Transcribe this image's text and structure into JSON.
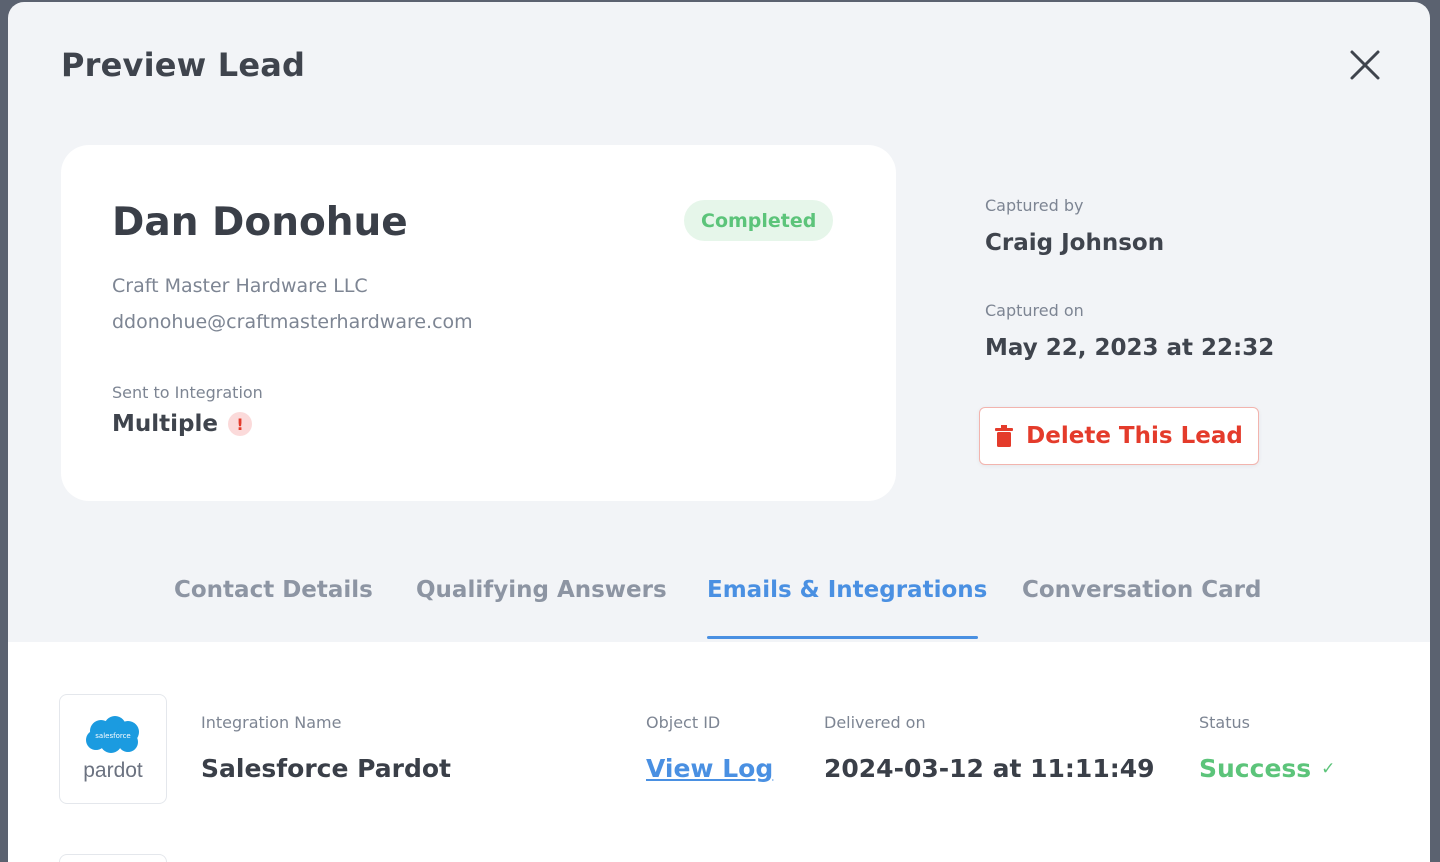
{
  "modal": {
    "title": "Preview Lead"
  },
  "lead": {
    "name": "Dan Donohue",
    "status": "Completed",
    "company": "Craft Master Hardware LLC",
    "email": "ddonohue@craftmasterhardware.com",
    "sent_label": "Sent to Integration",
    "sent_value": "Multiple",
    "alert_symbol": "!"
  },
  "meta": {
    "captured_by_label": "Captured by",
    "captured_by": "Craig Johnson",
    "captured_on_label": "Captured on",
    "captured_on": "May 22, 2023 at 22:32"
  },
  "actions": {
    "delete_label": "Delete This Lead"
  },
  "tabs": [
    {
      "label": "Contact Details",
      "active": false
    },
    {
      "label": "Qualifying Answers",
      "active": false
    },
    {
      "label": "Emails & Integrations",
      "active": true
    },
    {
      "label": "Conversation Card",
      "active": false
    }
  ],
  "integration": {
    "logo_brand": "salesforce",
    "logo_text": "pardot",
    "name_label": "Integration Name",
    "name": "Salesforce Pardot",
    "object_label": "Object ID",
    "object_link": "View Log",
    "delivered_label": "Delivered on",
    "delivered": "2024-03-12 at 11:11:49",
    "status_label": "Status",
    "status": "Success",
    "status_symbol": "✓"
  },
  "colors": {
    "accent": "#4a90e2",
    "success": "#5cc47a",
    "danger": "#e43b2b",
    "salesforce": "#1b9be0"
  }
}
